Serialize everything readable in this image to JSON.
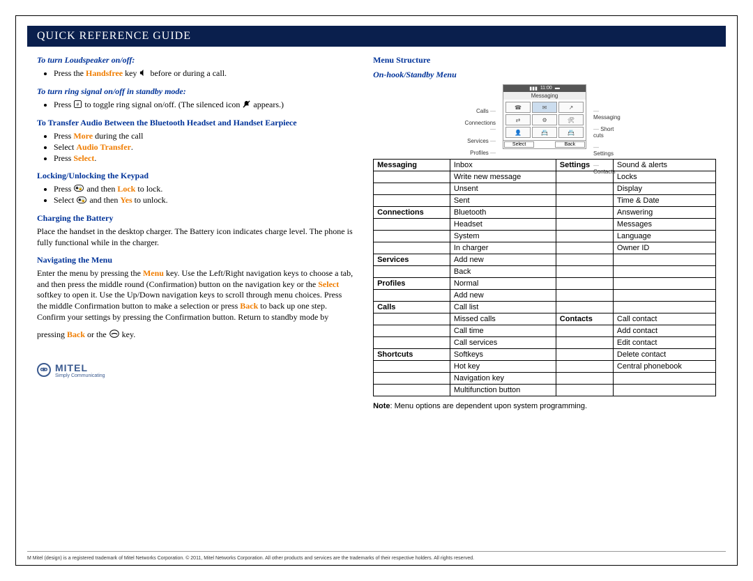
{
  "banner": "QUICK REFERENCE GUIDE",
  "left": {
    "s1_title": "To turn Loudspeaker on/off:",
    "s1_b1a": "Press the ",
    "s1_b1b": "Handsfree",
    "s1_b1c": " key ",
    "s1_b1d": " before or during a call.",
    "s2_title": "To turn ring signal on/off in standby mode:",
    "s2_b1a": "Press ",
    "s2_b1b": " to toggle ring signal on/off. (The silenced icon ",
    "s2_b1c": " appears.)",
    "s3_title": "To Transfer Audio Between the Bluetooth Headset and Handset Earpiece",
    "s3_b1a": "Press ",
    "s3_b1b": "More",
    "s3_b1c": " during the call",
    "s3_b2a": "Select ",
    "s3_b2b": "Audio Transfer",
    "s3_b2c": ".",
    "s3_b3a": "Press ",
    "s3_b3b": "Select",
    "s3_b3c": ".",
    "s4_title": "Locking/Unlocking the Keypad",
    "s4_b1a": "Press ",
    "s4_b1b": " and then ",
    "s4_b1c": "Lock",
    "s4_b1d": " to lock.",
    "s4_b2a": "Select ",
    "s4_b2b": " and then ",
    "s4_b2c": "Yes",
    "s4_b2d": " to unlock.",
    "s5_title": "Charging the Battery",
    "s5_p": "Place the handset in the desktop charger. The Battery icon indicates charge level. The phone is fully functional while in the charger.",
    "s6_title": "Navigating the Menu",
    "s6_p1a": "Enter the menu by pressing the ",
    "s6_p1b": "Menu",
    "s6_p1c": " key. Use the Left/Right navigation keys to choose a tab, and then press the middle round (Confirmation) button on the navigation key or the ",
    "s6_p1d": "Select",
    "s6_p1e": " softkey to open it. Use the Up/Down navigation keys to scroll through menu choices. Press the middle Confirmation button to make a selection or press ",
    "s6_p1f": "Back",
    "s6_p1g": " to back up one step. Confirm your settings by pressing the Confirmation button. Return to standby mode by",
    "s6_p2a": "pressing ",
    "s6_p2b": "Back",
    "s6_p2c": " or the ",
    "s6_p2d": " key."
  },
  "right": {
    "h1": "Menu Structure",
    "h2": "On-hook/Standby Menu",
    "phone": {
      "time": "11:00",
      "title": "Messaging",
      "sk_left": "Select",
      "sk_right": "Back",
      "l1": "Calls",
      "l2": "Connections",
      "l3": "Services",
      "l4": "Profiles",
      "r1": "Messaging",
      "r2": "Short cuts",
      "r3": "Settings",
      "r4": "Contacts"
    },
    "table": {
      "rows": [
        [
          "Messaging",
          "Inbox",
          "Settings",
          "Sound & alerts"
        ],
        [
          "",
          "Write new message",
          "",
          "Locks"
        ],
        [
          "",
          "Unsent",
          "",
          "Display"
        ],
        [
          "",
          "Sent",
          "",
          "Time & Date"
        ],
        [
          "Connections",
          "Bluetooth",
          "",
          "Answering"
        ],
        [
          "",
          "Headset",
          "",
          "Messages"
        ],
        [
          "",
          "System",
          "",
          "Language"
        ],
        [
          "",
          "In charger",
          "",
          "Owner ID"
        ],
        [
          "Services",
          "Add new",
          "",
          ""
        ],
        [
          "",
          "Back",
          "",
          ""
        ],
        [
          "Profiles",
          "Normal",
          "",
          ""
        ],
        [
          "",
          "Add new",
          "",
          ""
        ],
        [
          "Calls",
          "Call list",
          "",
          ""
        ],
        [
          "",
          "Missed calls",
          "Contacts",
          "Call contact"
        ],
        [
          "",
          "Call time",
          "",
          "Add contact"
        ],
        [
          "",
          "Call services",
          "",
          "Edit contact"
        ],
        [
          "Shortcuts",
          "Softkeys",
          "",
          "Delete contact"
        ],
        [
          "",
          "Hot key",
          "",
          "Central phonebook"
        ],
        [
          "",
          "Navigation key",
          "",
          ""
        ],
        [
          "",
          "Multifunction button",
          "",
          ""
        ]
      ]
    },
    "note_b": "Note",
    "note_t": ": Menu options are dependent upon system programming."
  },
  "logo": {
    "brand": "MITEL",
    "tag": "Simply Communicating",
    "mark": "⚮"
  },
  "legal": "M Mitel (design) is a registered trademark of Mitel Networks Corporation. © 2011, Mitel Networks Corporation. All other products and services are the trademarks of their respective holders. All rights reserved."
}
